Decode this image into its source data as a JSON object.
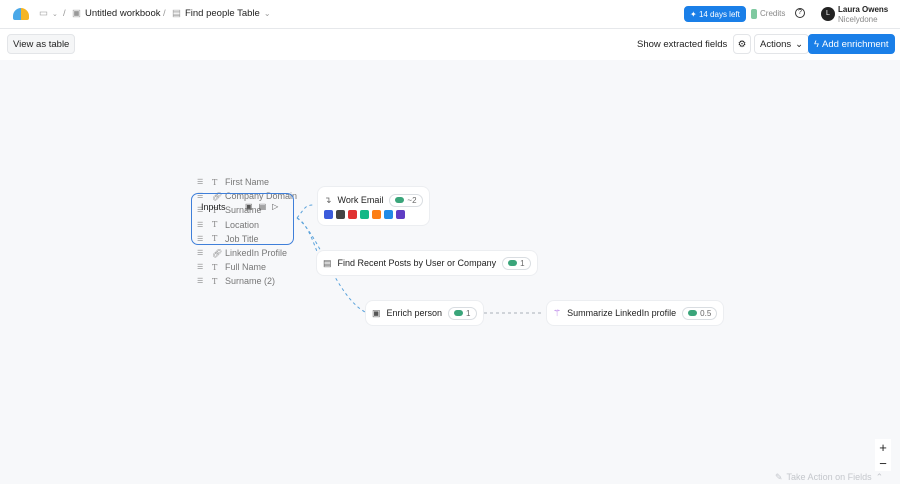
{
  "header": {
    "breadcrumb": [
      "Untitled workbook",
      "Find people Table"
    ],
    "trial": "14 days left",
    "credits": "Credits",
    "user": {
      "initial": "L",
      "name": "Laura Owens",
      "org": "Nicelydone"
    }
  },
  "toolbar": {
    "view_as_table": "View as table",
    "show_extracted": "Show extracted fields",
    "actions": "Actions",
    "add_enrichment": "Add enrichment"
  },
  "fields": [
    {
      "label": "First Name",
      "type": "text"
    },
    {
      "label": "Company Domain",
      "type": "link"
    },
    {
      "label": "Surname",
      "type": "text"
    },
    {
      "label": "Location",
      "type": "text"
    },
    {
      "label": "Job Title",
      "type": "text"
    },
    {
      "label": "LinkedIn Profile",
      "type": "link"
    },
    {
      "label": "Full Name",
      "type": "text"
    },
    {
      "label": "Surname (2)",
      "type": "text"
    }
  ],
  "inputs_label": "Inputs",
  "nodes": {
    "work_email": {
      "label": "Work Email",
      "cost": "~2"
    },
    "recent_posts": {
      "label": "Find Recent Posts by User or Company",
      "cost": "1"
    },
    "enrich_person": {
      "label": "Enrich person",
      "cost": "1"
    },
    "summarize": {
      "label": "Summarize LinkedIn profile",
      "cost": "0.5"
    }
  },
  "provider_colors": [
    "#3b5bdb",
    "#444",
    "#e03131",
    "#12b886",
    "#fd7e14",
    "#228be6",
    "#5f3dc4"
  ],
  "footer": {
    "take_action": "Take Action on Fields",
    "zoom_in": "+",
    "zoom_out": "−"
  },
  "colors": {
    "accent": "#1a7fe8",
    "selection": "#3f7fd9",
    "credit": "#3aa57a"
  }
}
